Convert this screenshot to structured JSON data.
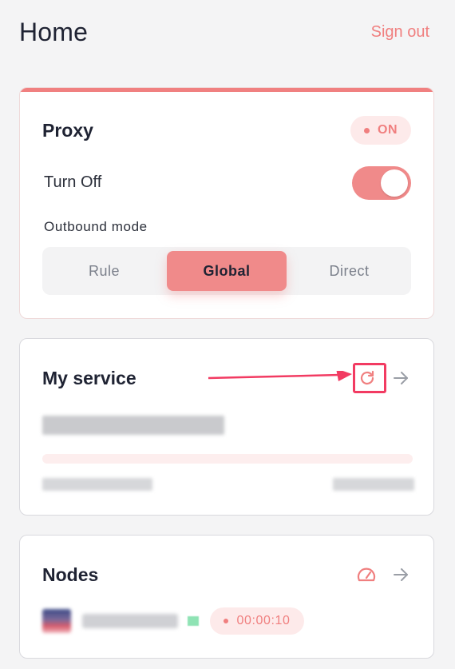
{
  "header": {
    "title": "Home",
    "sign_out": "Sign out"
  },
  "proxy": {
    "title": "Proxy",
    "status_badge": "ON",
    "toggle_label": "Turn Off",
    "toggle_on": true,
    "outbound_label": "Outbound mode",
    "modes": [
      "Rule",
      "Global",
      "Direct"
    ],
    "selected_mode": "Global"
  },
  "service": {
    "title": "My service",
    "plan_text": "",
    "usage_text": "",
    "expiry_text": ""
  },
  "nodes": {
    "title": "Nodes",
    "node_latency": "00:00:10"
  },
  "icons": {
    "refresh": "refresh-icon",
    "arrow": "arrow-right-icon",
    "speed": "speedometer-icon"
  },
  "colors": {
    "accent": "#f08080",
    "annotation": "#f23b62",
    "background": "#f4f4f5"
  }
}
